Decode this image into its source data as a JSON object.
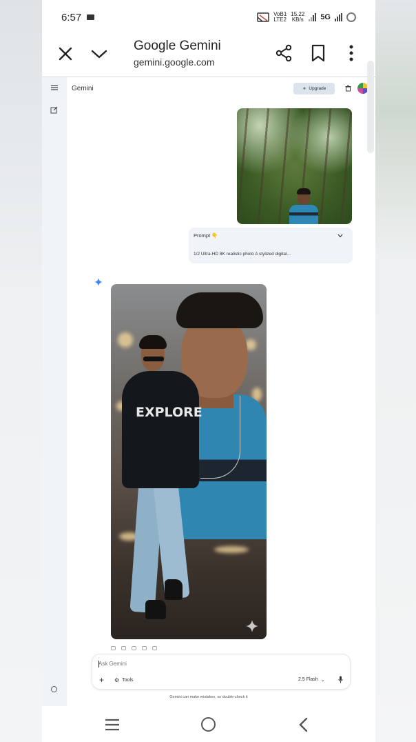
{
  "status_bar": {
    "time": "6:57",
    "network_line1": "VoB1",
    "network_line2": "LTE2",
    "speed_line1": "15.22",
    "speed_line2": "KB/s",
    "cellular": "5G"
  },
  "browser": {
    "title": "Google Gemini",
    "url": "gemini.google.com"
  },
  "gemini": {
    "app_name": "Gemini",
    "upgrade_label": "Upgrade",
    "prompt_card": {
      "heading": "Prompt 👇",
      "preview": "1/2 Ultra-HD 8K realistic photo A stylized digital..."
    },
    "generated_image": {
      "hoodie_text": "EXPLORE"
    },
    "input": {
      "placeholder": "Ask Gemini",
      "tools_label": "Tools",
      "model_label": "2.5 Flash"
    },
    "disclaimer": "Gemini can make mistakes, so double-check it"
  },
  "icons": {
    "close": "close-icon",
    "collapse": "chevron-down-icon",
    "share": "share-icon",
    "bookmark": "bookmark-icon",
    "more": "more-vert-icon",
    "menu": "menu-icon",
    "new_chat": "edit-icon",
    "sparkle": "gemini-spark-icon",
    "mic": "mic-icon"
  },
  "colors": {
    "accent_blue": "#4285f4",
    "upgrade_bg": "#dde3ea",
    "rail_bg": "#f0f4f9"
  }
}
